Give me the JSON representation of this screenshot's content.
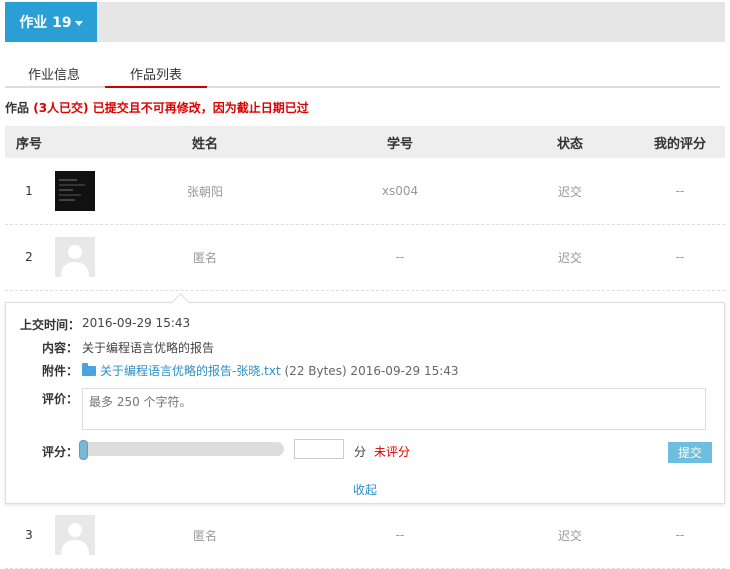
{
  "homework_menu": {
    "label": "作业 19"
  },
  "tabs": [
    {
      "label": "作业信息"
    },
    {
      "label": "作品列表"
    }
  ],
  "summary": {
    "prefix": "作品",
    "count": "(3人已交)",
    "notice": "已提交且不可再修改，因为截止日期已过"
  },
  "table": {
    "headers": [
      "序号",
      "姓名",
      "学号",
      "状态",
      "我的评分"
    ],
    "rows": [
      {
        "index": "1",
        "name": "张朝阳",
        "student_id": "xs004",
        "status": "迟交",
        "score": "--"
      },
      {
        "index": "2",
        "name": "匿名",
        "student_id": "--",
        "status": "迟交",
        "score": "--"
      },
      {
        "index": "3",
        "name": "匿名",
        "student_id": "--",
        "status": "迟交",
        "score": "--"
      }
    ]
  },
  "detail": {
    "submit_time_label": "上交时间：",
    "submit_time": "2016-09-29 15:43",
    "content_label": "内容：",
    "content": "关于编程语言优略的报告",
    "attachment_label": "附件：",
    "attachment_name": "关于编程语言优略的报告-张晓.txt",
    "attachment_meta": "(22 Bytes) 2016-09-29 15:43",
    "comment_label": "评价：",
    "comment_placeholder": "最多 250 个字符。",
    "score_label": "评分：",
    "score_value": 0,
    "score_unit": "分",
    "score_status": "未评分",
    "submit_button": "提交",
    "collapse_link": "收起"
  },
  "colors": {
    "accent": "#2a9fd6",
    "warning": "#d00000",
    "link": "#2a8fc8",
    "submit_button": "#6ebedf"
  }
}
